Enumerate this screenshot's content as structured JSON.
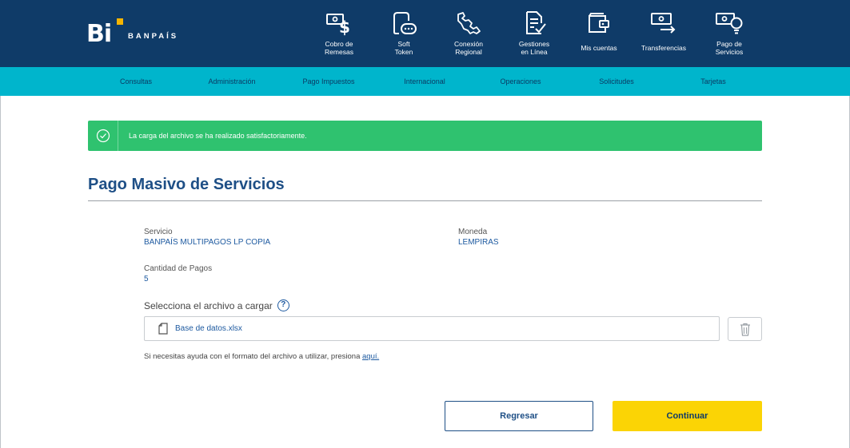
{
  "brand": {
    "logo_letters": "Bi",
    "name": "BANPAÍS"
  },
  "topnav": [
    {
      "line1": "Cobro de",
      "line2": "Remesas",
      "icon": "cash-dollar-icon"
    },
    {
      "line1": "Soft",
      "line2": "Token",
      "icon": "token-device-icon"
    },
    {
      "line1": "Conexión",
      "line2": "Regional",
      "icon": "regional-connection-icon"
    },
    {
      "line1": "Gestiones",
      "line2": "en Línea",
      "icon": "document-check-icon"
    },
    {
      "line1": "Mis cuentas",
      "line2": "",
      "icon": "wallet-icon"
    },
    {
      "line1": "Transferencias",
      "line2": "",
      "icon": "transfer-icon"
    },
    {
      "line1": "Pago de",
      "line2": "Servicios",
      "icon": "bill-bulb-icon"
    }
  ],
  "subnav": [
    "Consultas",
    "Administración",
    "Pago Impuestos",
    "Internacional",
    "Operaciones",
    "Solicitudes",
    "Tarjetas"
  ],
  "alert": {
    "message": "La carga del archivo se ha realizado satisfactoriamente."
  },
  "page": {
    "title": "Pago Masivo de Servicios",
    "servicio_label": "Servicio",
    "servicio_value": "BANPAÍS MULTIPAGOS LP COPIA",
    "moneda_label": "Moneda",
    "moneda_value": "LEMPIRAS",
    "cantidad_label": "Cantidad de Pagos",
    "cantidad_value": "5",
    "select_label": "Selecciona el archivo a cargar",
    "file_name": "Base de datos.xlsx",
    "help_text": "Si necesitas ayuda con el formato del archivo a utilizar, presiona ",
    "help_link": "aquí."
  },
  "buttons": {
    "back": "Regresar",
    "continue": "Continuar"
  },
  "colors": {
    "header": "#0f3b68",
    "subnav": "#00b5cc",
    "success": "#2fc26f",
    "primary_text": "#1e4f86",
    "continue_bg": "#fbd405"
  }
}
